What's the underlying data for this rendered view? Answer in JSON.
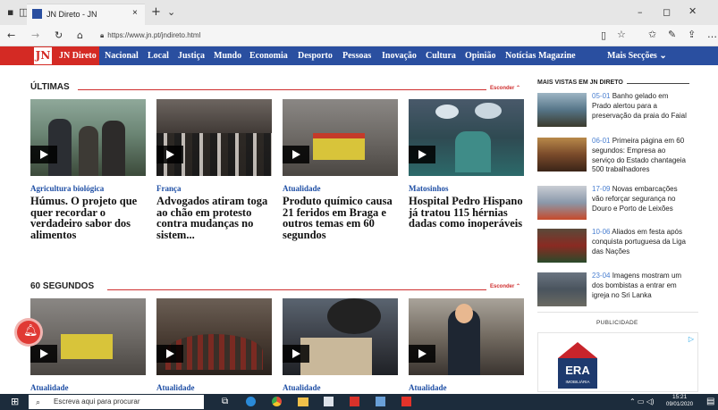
{
  "browser": {
    "tab_title": "JN Direto - JN",
    "url": "https://www.jn.pt/jndireto.html"
  },
  "nav": {
    "logo": "JN",
    "items": [
      "JN Direto",
      "Nacional",
      "Local",
      "Justiça",
      "Mundo",
      "Economia",
      "Desporto",
      "Pessoas",
      "Inovação",
      "Cultura",
      "Opinião",
      "Notícias Magazine"
    ],
    "more": "Mais Secções"
  },
  "ultimas": {
    "title": "ÚLTIMAS",
    "hide": "Esconder",
    "articles": [
      {
        "category": "Agricultura biológica",
        "title": "Húmus. O projeto que quer recordar o verdadeiro sabor dos alimentos"
      },
      {
        "category": "França",
        "title": "Advogados atiram toga ao chão em protesto contra mudanças no sistem..."
      },
      {
        "category": "Atualidade",
        "title": "Produto químico causa 21 feridos em Braga e outros temas em 60 segundos"
      },
      {
        "category": "Matosinhos",
        "title": "Hospital Pedro Hispano já tratou 115 hérnias dadas como inoperáveis"
      }
    ]
  },
  "sessenta": {
    "title": "60 SEGUNDOS",
    "hide": "Esconder",
    "categories": [
      "Atualidade",
      "Atualidade",
      "Atualidade",
      "Atualidade"
    ]
  },
  "side": {
    "title": "MAIS VISTAS EM JN DIRETO",
    "items": [
      {
        "date": "05-01",
        "text": "Banho gelado em Prado alertou para a preservação da praia do Faial"
      },
      {
        "date": "06-01",
        "text": "Primeira página em 60 segundos: Empresa ao serviço do Estado chantageia 500 trabalhadores"
      },
      {
        "date": "17-09",
        "text": "Novas embarcações vão reforçar segurança no Douro e Porto de Leixões"
      },
      {
        "date": "10-06",
        "text": "Aliados em festa após conquista portuguesa da Liga das Nações"
      },
      {
        "date": "23-04",
        "text": "Imagens mostram um dos bombistas a entrar em igreja no Sri Lanka"
      }
    ],
    "ad_label": "PUBLICIDADE",
    "ad_brand": "ERA",
    "ad_sub": "IMOBILIÁRIA"
  },
  "taskbar": {
    "search_placeholder": "Escreva aqui para procurar",
    "time": "15:21",
    "date": "09/01/2020"
  },
  "colors": {
    "accent": "#d42a24",
    "nav": "#2a4fa0",
    "category": "#1f4fa5"
  }
}
